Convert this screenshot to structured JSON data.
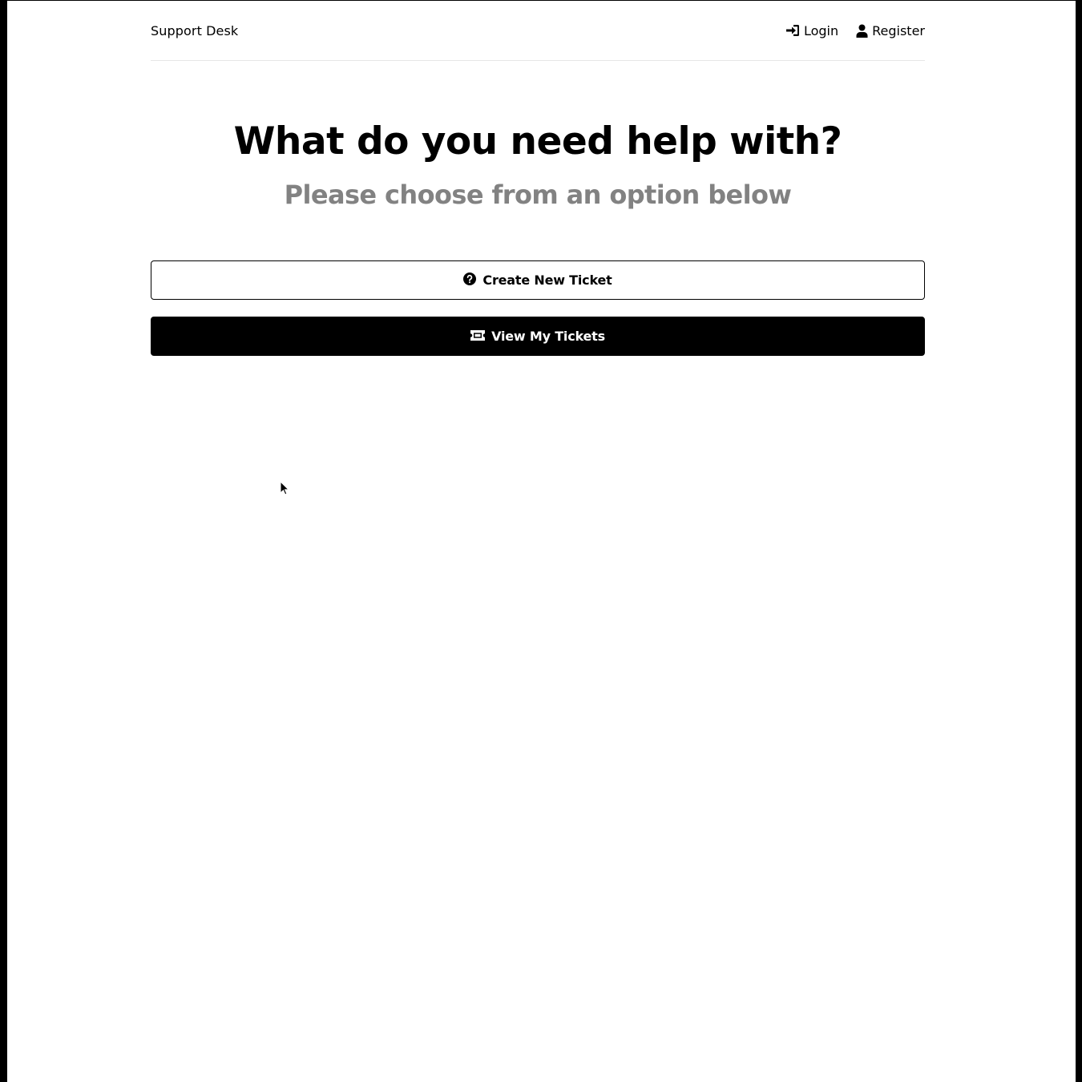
{
  "header": {
    "brand": "Support Desk",
    "nav": {
      "login_label": "Login",
      "login_icon": "sign-in-icon",
      "register_label": "Register",
      "register_icon": "user-icon"
    }
  },
  "main": {
    "title": "What do you need help with?",
    "subtitle": "Please choose from an option below",
    "actions": {
      "create_label": "Create New Ticket",
      "create_icon": "question-circle-icon",
      "view_label": "View My Tickets",
      "view_icon": "ticket-icon"
    }
  },
  "colors": {
    "text": "#000000",
    "muted": "#828282",
    "primary_button": "#000000",
    "divider": "#e6e6e6"
  }
}
